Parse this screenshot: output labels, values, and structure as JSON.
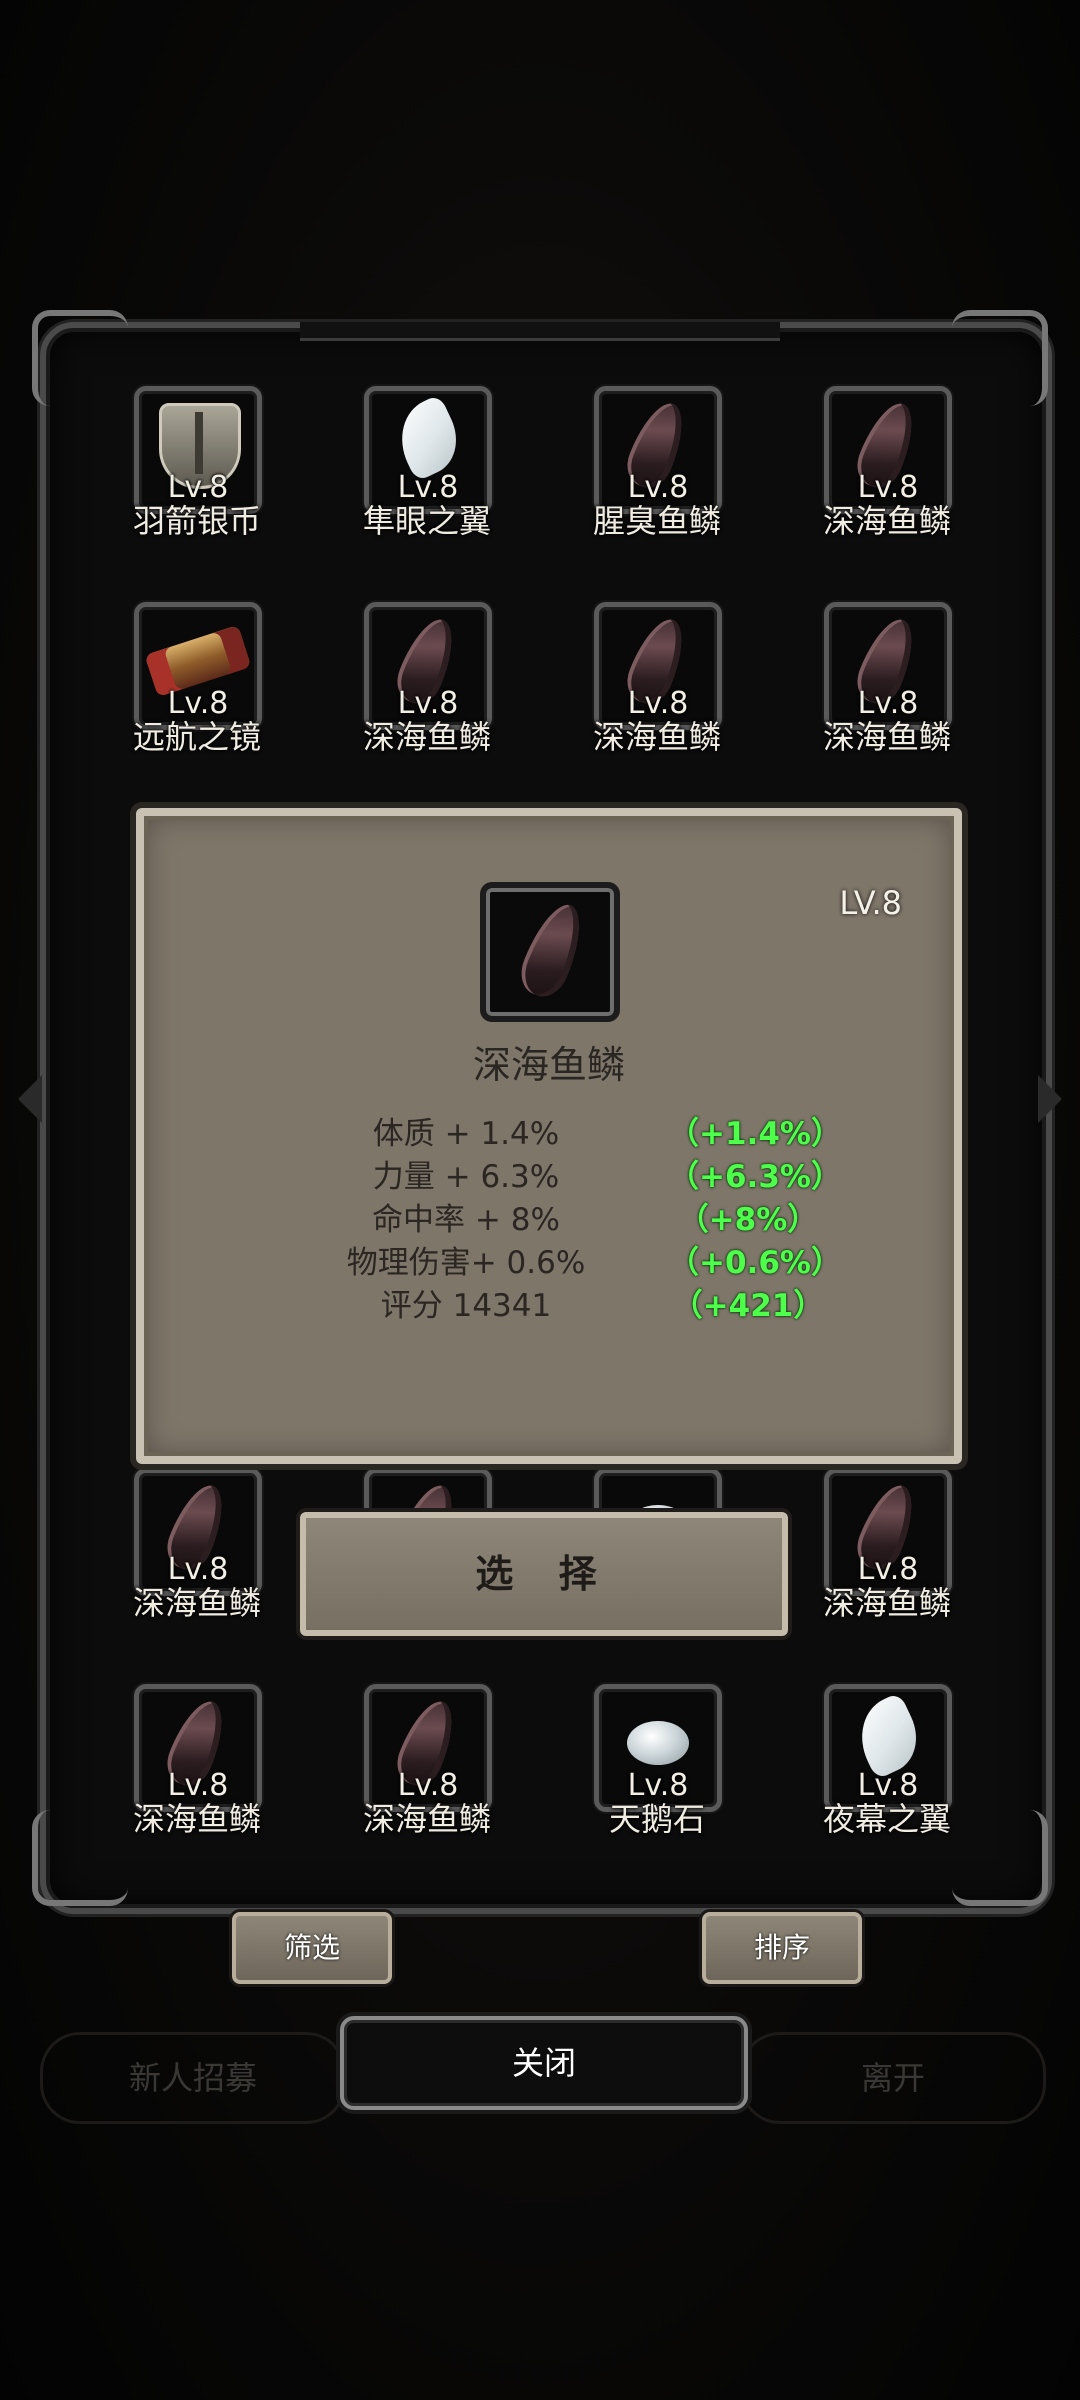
{
  "items": [
    {
      "name": "羽箭银币",
      "level": "Lv.8",
      "icon": "silver-coin-icon"
    },
    {
      "name": "隼眼之翼",
      "level": "Lv.8",
      "icon": "wing-icon"
    },
    {
      "name": "腥臭鱼鳞",
      "level": "Lv.8",
      "icon": "fish-scale-icon"
    },
    {
      "name": "深海鱼鳞",
      "level": "Lv.8",
      "icon": "fish-scale-icon"
    },
    {
      "name": "远航之镜",
      "level": "Lv.8",
      "icon": "telescope-icon"
    },
    {
      "name": "深海鱼鳞",
      "level": "Lv.8",
      "icon": "fish-scale-icon"
    },
    {
      "name": "深海鱼鳞",
      "level": "Lv.8",
      "icon": "fish-scale-icon"
    },
    {
      "name": "深海鱼鳞",
      "level": "Lv.8",
      "icon": "fish-scale-icon"
    },
    {
      "name": "深海鱼鳞",
      "level": "Lv.8",
      "icon": "fish-scale-icon"
    },
    {
      "name": "深海鱼鳞",
      "level": "Lv.8",
      "icon": "fish-scale-icon"
    },
    {
      "name": "深海鱼鳞",
      "level": "Lv.8",
      "icon": "fish-scale-icon"
    },
    {
      "name": "深海鱼鳞",
      "level": "Lv.8",
      "icon": "fish-scale-icon"
    },
    {
      "name": "天鹅石",
      "level": "Lv.8",
      "icon": "swan-stone-icon"
    },
    {
      "name": "夜幕之翼",
      "level": "Lv.8",
      "icon": "wing-icon"
    }
  ],
  "detail": {
    "level": "LV.8",
    "name": "深海鱼鳞",
    "stats": [
      {
        "label": "体质 + 1.4%",
        "delta": "（+1.4%）"
      },
      {
        "label": "力量 + 6.3%",
        "delta": "（+6.3%）"
      },
      {
        "label": "命中率 + 8%",
        "delta": "（+8%）"
      },
      {
        "label": "物理伤害+ 0.6%",
        "delta": "（+0.6%）"
      },
      {
        "label": "评分 14341",
        "delta": "（+421）"
      }
    ],
    "select_label": "选 择"
  },
  "footer": {
    "filter_label": "筛选",
    "sort_label": "排序",
    "close_label": "关闭",
    "bg_recruit": "新人招募",
    "bg_leave": "离开"
  },
  "colors": {
    "stat_delta": "#4dff4a",
    "panel": "#7f766a",
    "frame": "#4a4a4a"
  }
}
